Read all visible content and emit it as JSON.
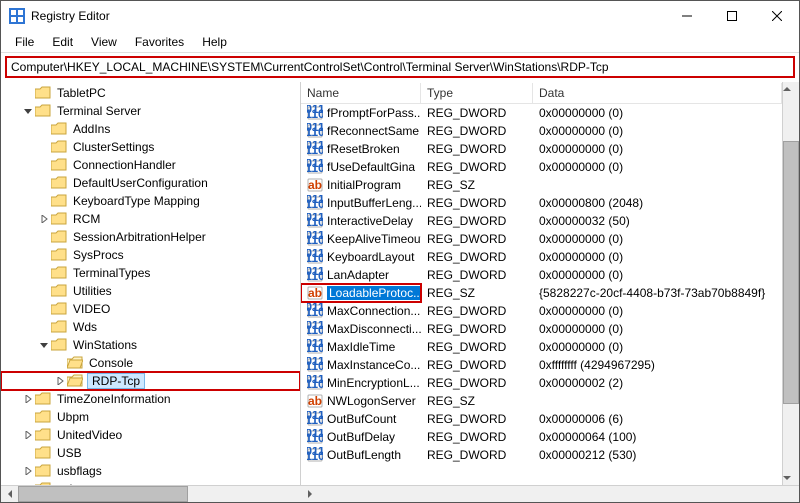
{
  "window": {
    "title": "Registry Editor"
  },
  "menu": {
    "file": "File",
    "edit": "Edit",
    "view": "View",
    "favorites": "Favorites",
    "help": "Help"
  },
  "address": "Computer\\HKEY_LOCAL_MACHINE\\SYSTEM\\CurrentControlSet\\Control\\Terminal Server\\WinStations\\RDP-Tcp",
  "tree": {
    "items": [
      {
        "depth": 1,
        "exp": "none",
        "label": "TabletPC"
      },
      {
        "depth": 1,
        "exp": "open",
        "label": "Terminal Server"
      },
      {
        "depth": 2,
        "exp": "none",
        "label": "AddIns"
      },
      {
        "depth": 2,
        "exp": "none",
        "label": "ClusterSettings"
      },
      {
        "depth": 2,
        "exp": "none",
        "label": "ConnectionHandler"
      },
      {
        "depth": 2,
        "exp": "none",
        "label": "DefaultUserConfiguration"
      },
      {
        "depth": 2,
        "exp": "none",
        "label": "KeyboardType Mapping"
      },
      {
        "depth": 2,
        "exp": "closed",
        "label": "RCM"
      },
      {
        "depth": 2,
        "exp": "none",
        "label": "SessionArbitrationHelper"
      },
      {
        "depth": 2,
        "exp": "none",
        "label": "SysProcs"
      },
      {
        "depth": 2,
        "exp": "none",
        "label": "TerminalTypes"
      },
      {
        "depth": 2,
        "exp": "none",
        "label": "Utilities"
      },
      {
        "depth": 2,
        "exp": "none",
        "label": "VIDEO"
      },
      {
        "depth": 2,
        "exp": "none",
        "label": "Wds"
      },
      {
        "depth": 2,
        "exp": "open",
        "label": "WinStations"
      },
      {
        "depth": 3,
        "exp": "none",
        "label": "Console",
        "open": true
      },
      {
        "depth": 3,
        "exp": "closed",
        "label": "RDP-Tcp",
        "open": true,
        "selected": true,
        "outlined": true
      },
      {
        "depth": 1,
        "exp": "closed",
        "label": "TimeZoneInformation"
      },
      {
        "depth": 1,
        "exp": "none",
        "label": "Ubpm"
      },
      {
        "depth": 1,
        "exp": "closed",
        "label": "UnitedVideo"
      },
      {
        "depth": 1,
        "exp": "none",
        "label": "USB"
      },
      {
        "depth": 1,
        "exp": "closed",
        "label": "usbflags"
      },
      {
        "depth": 1,
        "exp": "none",
        "label": "usbstor"
      }
    ]
  },
  "columns": {
    "name": "Name",
    "type": "Type",
    "data": "Data"
  },
  "values": [
    {
      "icon": "bin",
      "name": "fPromptForPass...",
      "type": "REG_DWORD",
      "data": "0x00000000 (0)"
    },
    {
      "icon": "bin",
      "name": "fReconnectSame",
      "type": "REG_DWORD",
      "data": "0x00000000 (0)"
    },
    {
      "icon": "bin",
      "name": "fResetBroken",
      "type": "REG_DWORD",
      "data": "0x00000000 (0)"
    },
    {
      "icon": "bin",
      "name": "fUseDefaultGina",
      "type": "REG_DWORD",
      "data": "0x00000000 (0)"
    },
    {
      "icon": "str",
      "name": "InitialProgram",
      "type": "REG_SZ",
      "data": ""
    },
    {
      "icon": "bin",
      "name": "InputBufferLeng...",
      "type": "REG_DWORD",
      "data": "0x00000800 (2048)"
    },
    {
      "icon": "bin",
      "name": "InteractiveDelay",
      "type": "REG_DWORD",
      "data": "0x00000032 (50)"
    },
    {
      "icon": "bin",
      "name": "KeepAliveTimeout",
      "type": "REG_DWORD",
      "data": "0x00000000 (0)"
    },
    {
      "icon": "bin",
      "name": "KeyboardLayout",
      "type": "REG_DWORD",
      "data": "0x00000000 (0)"
    },
    {
      "icon": "bin",
      "name": "LanAdapter",
      "type": "REG_DWORD",
      "data": "0x00000000 (0)"
    },
    {
      "icon": "str",
      "name": "LoadableProtoc...",
      "type": "REG_SZ",
      "data": "{5828227c-20cf-4408-b73f-73ab70b8849f}",
      "selected": true,
      "outlined": true
    },
    {
      "icon": "bin",
      "name": "MaxConnection...",
      "type": "REG_DWORD",
      "data": "0x00000000 (0)"
    },
    {
      "icon": "bin",
      "name": "MaxDisconnecti...",
      "type": "REG_DWORD",
      "data": "0x00000000 (0)"
    },
    {
      "icon": "bin",
      "name": "MaxIdleTime",
      "type": "REG_DWORD",
      "data": "0x00000000 (0)"
    },
    {
      "icon": "bin",
      "name": "MaxInstanceCo...",
      "type": "REG_DWORD",
      "data": "0xffffffff (4294967295)"
    },
    {
      "icon": "bin",
      "name": "MinEncryptionL...",
      "type": "REG_DWORD",
      "data": "0x00000002 (2)"
    },
    {
      "icon": "str",
      "name": "NWLogonServer",
      "type": "REG_SZ",
      "data": ""
    },
    {
      "icon": "bin",
      "name": "OutBufCount",
      "type": "REG_DWORD",
      "data": "0x00000006 (6)"
    },
    {
      "icon": "bin",
      "name": "OutBufDelay",
      "type": "REG_DWORD",
      "data": "0x00000064 (100)"
    },
    {
      "icon": "bin",
      "name": "OutBufLength",
      "type": "REG_DWORD",
      "data": "0x00000212 (530)"
    }
  ]
}
